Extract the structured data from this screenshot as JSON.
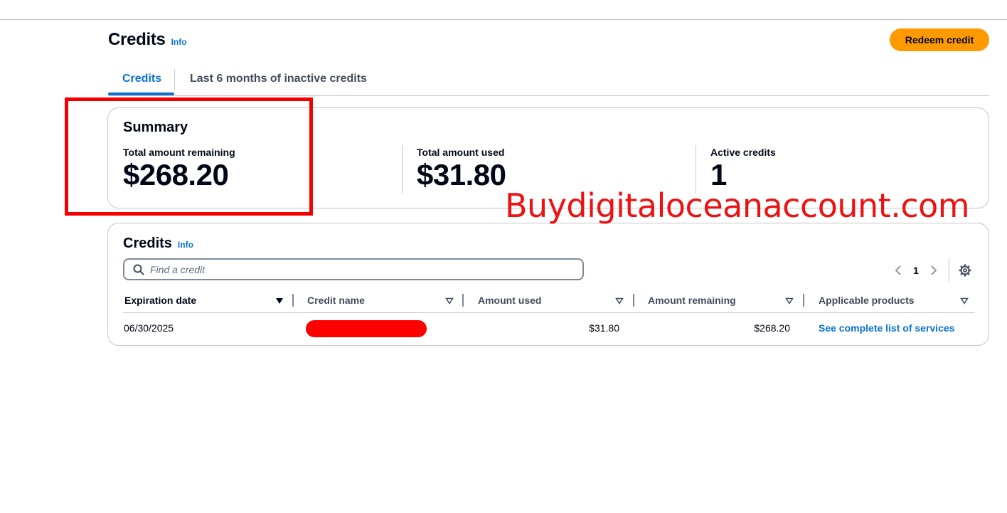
{
  "header": {
    "title": "Credits",
    "info_label": "Info",
    "redeem_label": "Redeem credit"
  },
  "tabs": [
    {
      "label": "Credits",
      "active": true
    },
    {
      "label": "Last 6 months of inactive credits",
      "active": false
    }
  ],
  "summary": {
    "title": "Summary",
    "stats": [
      {
        "label": "Total amount remaining",
        "value": "$268.20"
      },
      {
        "label": "Total amount used",
        "value": "$31.80"
      },
      {
        "label": "Active credits",
        "value": "1"
      }
    ]
  },
  "watermark": "Buydigitaloceanaccount.com",
  "credits_table": {
    "title": "Credits",
    "info_label": "Info",
    "search_placeholder": "Find a credit",
    "current_page": "1",
    "columns": [
      "Expiration date",
      "Credit name",
      "Amount used",
      "Amount remaining",
      "Applicable products"
    ],
    "rows": [
      {
        "expiration_date": "06/30/2025",
        "credit_name": "",
        "amount_used": "$31.80",
        "amount_remaining": "$268.20",
        "applicable_products": "See complete list of services"
      }
    ]
  },
  "colors": {
    "accent": "#0972d3",
    "primary_button": "#ff9900",
    "highlight": "#f40000",
    "text": "#000716"
  },
  "icons": [
    "search-icon",
    "chevron-left-icon",
    "chevron-right-icon",
    "gear-icon",
    "sort-descending-icon",
    "sort-icon"
  ]
}
